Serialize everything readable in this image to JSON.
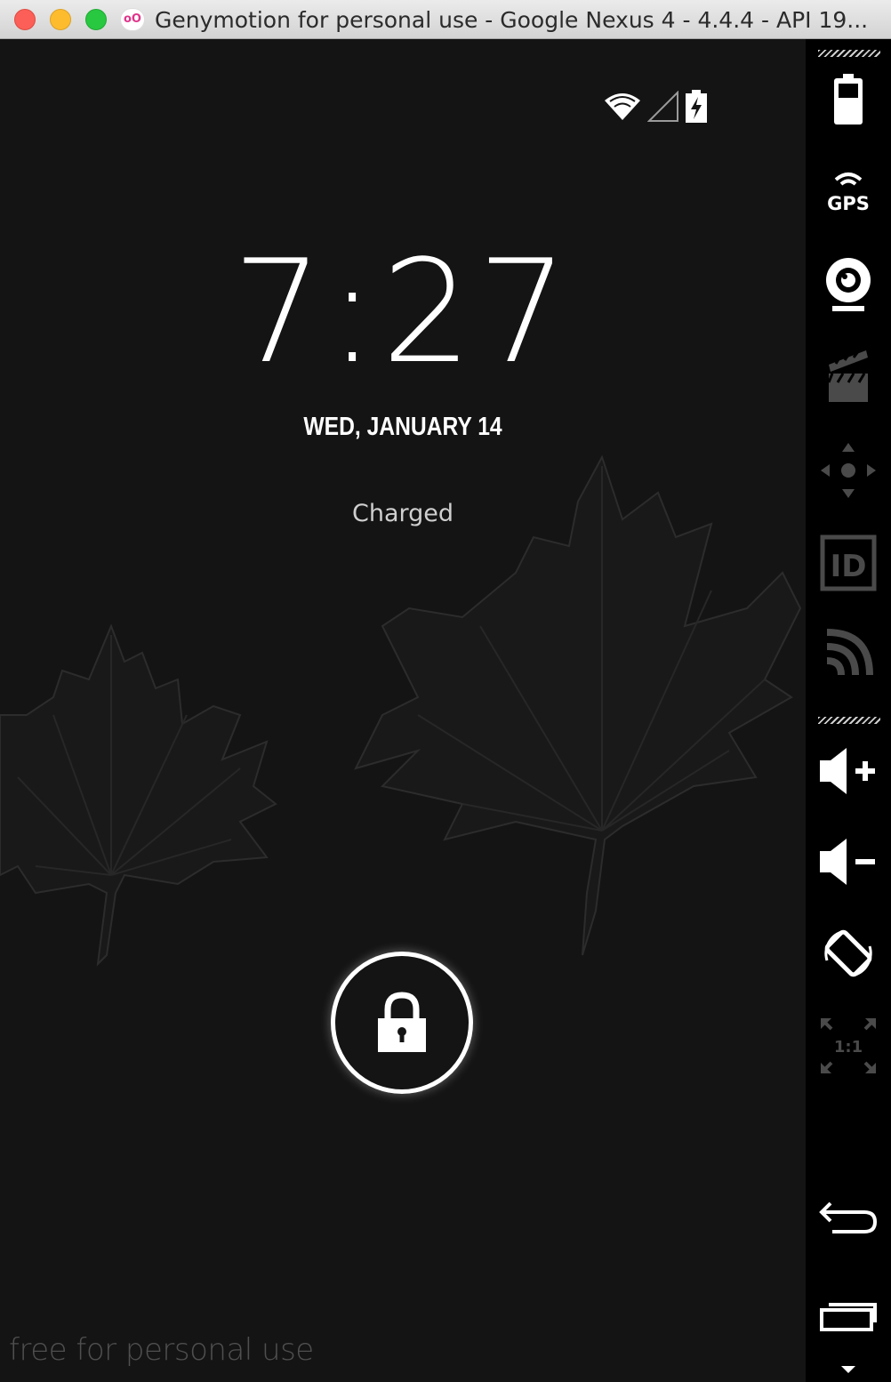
{
  "window": {
    "title": "Genymotion for personal use - Google Nexus 4 - 4.4.4 - API 19...",
    "app_icon_text": "oO"
  },
  "lockscreen": {
    "time": "7:27",
    "date": "WED, JANUARY 14",
    "battery_status": "Charged"
  },
  "watermark": "free for personal use",
  "toolbar": {
    "items": [
      {
        "name": "battery",
        "icon": "battery-icon"
      },
      {
        "name": "gps",
        "icon": "gps-icon",
        "label": "GPS"
      },
      {
        "name": "webcam",
        "icon": "webcam-icon"
      },
      {
        "name": "screencast",
        "icon": "clapperboard-icon"
      },
      {
        "name": "remote-control",
        "icon": "dpad-icon"
      },
      {
        "name": "identifiers",
        "icon": "id-icon",
        "label": "ID"
      },
      {
        "name": "network",
        "icon": "signal-arcs-icon"
      },
      {
        "name": "volume-up",
        "icon": "volume-up-icon"
      },
      {
        "name": "volume-down",
        "icon": "volume-down-icon"
      },
      {
        "name": "rotate",
        "icon": "rotate-icon"
      },
      {
        "name": "pixel-perfect",
        "icon": "scale-icon",
        "label": "1:1"
      },
      {
        "name": "back",
        "icon": "back-arrow-icon"
      },
      {
        "name": "recent-apps",
        "icon": "recent-apps-icon"
      }
    ]
  },
  "colors": {
    "screen_bg": "#141414",
    "toolbar_bg": "#000000",
    "text_white": "#ffffff",
    "watermark": "#4f4f4f",
    "leaf_line": "#2b2b2b"
  }
}
